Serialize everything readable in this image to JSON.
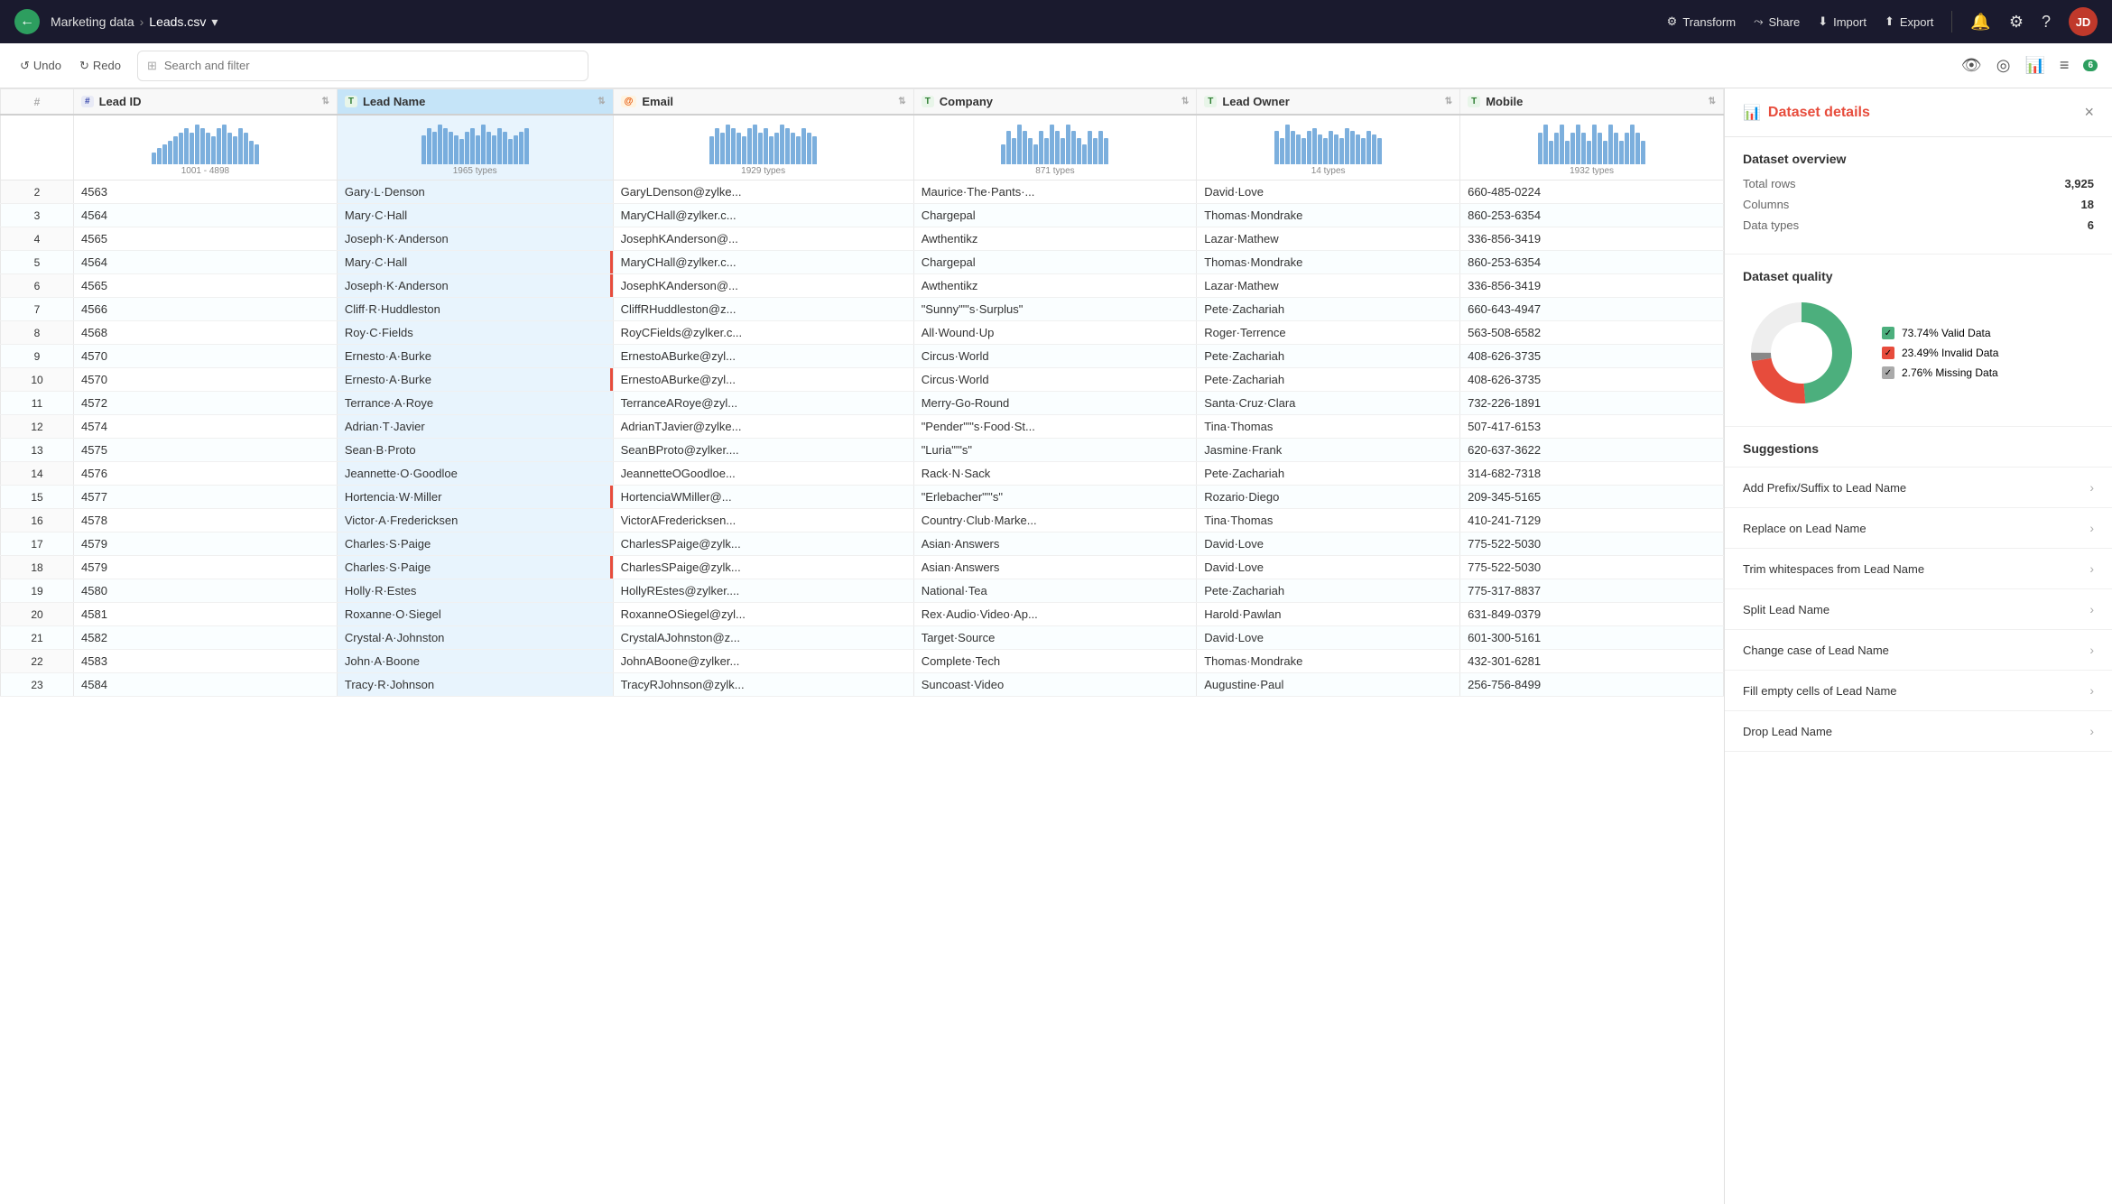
{
  "topnav": {
    "back_icon": "←",
    "project": "Marketing data",
    "separator": "›",
    "filename": "Leads.csv",
    "dropdown_icon": "▾",
    "transform_label": "Transform",
    "share_label": "Share",
    "import_label": "Import",
    "export_label": "Export",
    "badge_count": "6",
    "avatar_initials": "JD"
  },
  "toolbar": {
    "undo_label": "Undo",
    "redo_label": "Redo",
    "search_placeholder": "Search and filter"
  },
  "columns": [
    {
      "id": "row_num",
      "label": "#",
      "type": "num"
    },
    {
      "id": "lead_id",
      "label": "Lead ID",
      "type": "hash"
    },
    {
      "id": "lead_name",
      "label": "Lead Name",
      "type": "T"
    },
    {
      "id": "email",
      "label": "Email",
      "type": "at"
    },
    {
      "id": "company",
      "label": "Company",
      "type": "T"
    },
    {
      "id": "lead_owner",
      "label": "Lead Owner",
      "type": "T"
    },
    {
      "id": "mobile",
      "label": "Mobile",
      "type": "T"
    }
  ],
  "histogram": {
    "lead_id": {
      "label": "1001 - 4898",
      "bars": [
        3,
        4,
        5,
        6,
        7,
        8,
        9,
        8,
        10,
        9,
        8,
        7,
        9,
        10,
        8,
        7,
        9,
        8,
        6,
        5
      ]
    },
    "lead_name": {
      "label": "1965 types",
      "bars": [
        8,
        10,
        9,
        11,
        10,
        9,
        8,
        7,
        9,
        10,
        8,
        11,
        9,
        8,
        10,
        9,
        7,
        8,
        9,
        10
      ]
    },
    "email": {
      "label": "1929 types",
      "bars": [
        7,
        9,
        8,
        10,
        9,
        8,
        7,
        9,
        10,
        8,
        9,
        7,
        8,
        10,
        9,
        8,
        7,
        9,
        8,
        7
      ]
    },
    "company": {
      "label": "871 types",
      "bars": [
        3,
        5,
        4,
        6,
        5,
        4,
        3,
        5,
        4,
        6,
        5,
        4,
        6,
        5,
        4,
        3,
        5,
        4,
        5,
        4
      ]
    },
    "lead_owner": {
      "label": "14 types",
      "bars": [
        10,
        8,
        12,
        10,
        9,
        8,
        10,
        11,
        9,
        8,
        10,
        9,
        8,
        11,
        10,
        9,
        8,
        10,
        9,
        8
      ]
    },
    "mobile": {
      "label": "1932 types",
      "bars": [
        4,
        5,
        3,
        4,
        5,
        3,
        4,
        5,
        4,
        3,
        5,
        4,
        3,
        5,
        4,
        3,
        4,
        5,
        4,
        3
      ]
    }
  },
  "rows": [
    {
      "num": 2,
      "lead_id": "4563",
      "lead_name": "Gary·L·Denson",
      "email": "GaryLDenson@zylke...",
      "company": "Maurice·The·Pants·...",
      "lead_owner": "David·Love",
      "mobile": "660-485-0224",
      "invalid": false
    },
    {
      "num": 3,
      "lead_id": "4564",
      "lead_name": "Mary·C·Hall",
      "email": "MaryCHall@zylker.c...",
      "company": "Chargepal",
      "lead_owner": "Thomas·Mondrake",
      "mobile": "860-253-6354",
      "invalid": false
    },
    {
      "num": 4,
      "lead_id": "4565",
      "lead_name": "Joseph·K·Anderson",
      "email": "JosephKAnderson@...",
      "company": "Awthentikz",
      "lead_owner": "Lazar·Mathew",
      "mobile": "336-856-3419",
      "invalid": false
    },
    {
      "num": 5,
      "lead_id": "4564",
      "lead_name": "Mary·C·Hall",
      "email": "MaryCHall@zylker.c...",
      "company": "Chargepal",
      "lead_owner": "Thomas·Mondrake",
      "mobile": "860-253-6354",
      "invalid": true
    },
    {
      "num": 6,
      "lead_id": "4565",
      "lead_name": "Joseph·K·Anderson",
      "email": "JosephKAnderson@...",
      "company": "Awthentikz",
      "lead_owner": "Lazar·Mathew",
      "mobile": "336-856-3419",
      "invalid": true
    },
    {
      "num": 7,
      "lead_id": "4566",
      "lead_name": "Cliff·R·Huddleston",
      "email": "CliffRHuddleston@z...",
      "company": "\"Sunny\"\"'s·Surplus\"",
      "lead_owner": "Pete·Zachariah",
      "mobile": "660-643-4947",
      "invalid": false
    },
    {
      "num": 8,
      "lead_id": "4568",
      "lead_name": "Roy·C·Fields",
      "email": "RoyCFields@zylker.c...",
      "company": "All·Wound·Up",
      "lead_owner": "Roger·Terrence",
      "mobile": "563-508-6582",
      "invalid": false
    },
    {
      "num": 9,
      "lead_id": "4570",
      "lead_name": "Ernesto·A·Burke",
      "email": "ErnestoABurke@zyl...",
      "company": "Circus·World",
      "lead_owner": "Pete·Zachariah",
      "mobile": "408-626-3735",
      "invalid": false
    },
    {
      "num": 10,
      "lead_id": "4570",
      "lead_name": "Ernesto·A·Burke",
      "email": "ErnestoABurke@zyl...",
      "company": "Circus·World",
      "lead_owner": "Pete·Zachariah",
      "mobile": "408-626-3735",
      "invalid": true
    },
    {
      "num": 11,
      "lead_id": "4572",
      "lead_name": "Terrance·A·Roye",
      "email": "TerranceARoye@zyl...",
      "company": "Merry-Go-Round",
      "lead_owner": "Santa·Cruz·Clara",
      "mobile": "732-226-1891",
      "invalid": false
    },
    {
      "num": 12,
      "lead_id": "4574",
      "lead_name": "Adrian·T·Javier",
      "email": "AdrianTJavier@zylke...",
      "company": "\"Pender\"\"'s·Food·St...",
      "lead_owner": "Tina·Thomas",
      "mobile": "507-417-6153",
      "invalid": false
    },
    {
      "num": 13,
      "lead_id": "4575",
      "lead_name": "Sean·B·Proto",
      "email": "SeanBProto@zylker....",
      "company": "\"Luria\"\"'s\"",
      "lead_owner": "Jasmine·Frank",
      "mobile": "620-637-3622",
      "invalid": false
    },
    {
      "num": 14,
      "lead_id": "4576",
      "lead_name": "Jeannette·O·Goodloe",
      "email": "JeannetteOGoodloe...",
      "company": "Rack·N·Sack",
      "lead_owner": "Pete·Zachariah",
      "mobile": "314-682-7318",
      "invalid": false
    },
    {
      "num": 15,
      "lead_id": "4577",
      "lead_name": "Hortencia·W·Miller",
      "email": "HortenciaWMiller@...",
      "company": "\"Erlebacher\"\"'s\"",
      "lead_owner": "Rozario·Diego",
      "mobile": "209-345-5165",
      "invalid": true
    },
    {
      "num": 16,
      "lead_id": "4578",
      "lead_name": "Victor·A·Fredericksen",
      "email": "VictorAFredericksen...",
      "company": "Country·Club·Marke...",
      "lead_owner": "Tina·Thomas",
      "mobile": "410-241-7129",
      "invalid": false
    },
    {
      "num": 17,
      "lead_id": "4579",
      "lead_name": "Charles·S·Paige",
      "email": "CharlesSPaige@zylk...",
      "company": "Asian·Answers",
      "lead_owner": "David·Love",
      "mobile": "775-522-5030",
      "invalid": false
    },
    {
      "num": 18,
      "lead_id": "4579",
      "lead_name": "Charles·S·Paige",
      "email": "CharlesSPaige@zylk...",
      "company": "Asian·Answers",
      "lead_owner": "David·Love",
      "mobile": "775-522-5030",
      "invalid": true
    },
    {
      "num": 19,
      "lead_id": "4580",
      "lead_name": "Holly·R·Estes",
      "email": "HollyREstes@zylker....",
      "company": "National·Tea",
      "lead_owner": "Pete·Zachariah",
      "mobile": "775-317-8837",
      "invalid": false
    },
    {
      "num": 20,
      "lead_id": "4581",
      "lead_name": "Roxanne·O·Siegel",
      "email": "RoxanneOSiegel@zyl...",
      "company": "Rex·Audio·Video·Ap...",
      "lead_owner": "Harold·Pawlan",
      "mobile": "631-849-0379",
      "invalid": false
    },
    {
      "num": 21,
      "lead_id": "4582",
      "lead_name": "Crystal·A·Johnston",
      "email": "CrystalAJohnston@z...",
      "company": "Target·Source",
      "lead_owner": "David·Love",
      "mobile": "601-300-5161",
      "invalid": false
    },
    {
      "num": 22,
      "lead_id": "4583",
      "lead_name": "John·A·Boone",
      "email": "JohnABoone@zylker...",
      "company": "Complete·Tech",
      "lead_owner": "Thomas·Mondrake",
      "mobile": "432-301-6281",
      "invalid": false
    },
    {
      "num": 23,
      "lead_id": "4584",
      "lead_name": "Tracy·R·Johnson",
      "email": "TracyRJohnson@zylk...",
      "company": "Suncoast·Video",
      "lead_owner": "Augustine·Paul",
      "mobile": "256-756-8499",
      "invalid": false
    }
  ],
  "panel": {
    "title": "Dataset details",
    "close_icon": "×",
    "overview": {
      "title": "Dataset overview",
      "total_rows_label": "Total rows",
      "total_rows_value": "3,925",
      "columns_label": "Columns",
      "columns_value": "18",
      "data_types_label": "Data types",
      "data_types_value": "6"
    },
    "quality": {
      "title": "Dataset quality",
      "valid_pct": 73.74,
      "invalid_pct": 23.49,
      "missing_pct": 2.76,
      "valid_label": "73.74% Valid Data",
      "invalid_label": "23.49% Invalid Data",
      "missing_label": "2.76% Missing Data",
      "valid_color": "#4caf7d",
      "invalid_color": "#e74c3c",
      "missing_color": "#666"
    },
    "suggestions": {
      "title": "Suggestions",
      "items": [
        {
          "label": "Add Prefix/Suffix to Lead Name"
        },
        {
          "label": "Replace on Lead Name"
        },
        {
          "label": "Trim whitespaces from Lead Name"
        },
        {
          "label": "Split Lead Name"
        },
        {
          "label": "Change case of Lead Name"
        },
        {
          "label": "Fill empty cells of Lead Name"
        },
        {
          "label": "Drop Lead Name"
        }
      ]
    }
  }
}
